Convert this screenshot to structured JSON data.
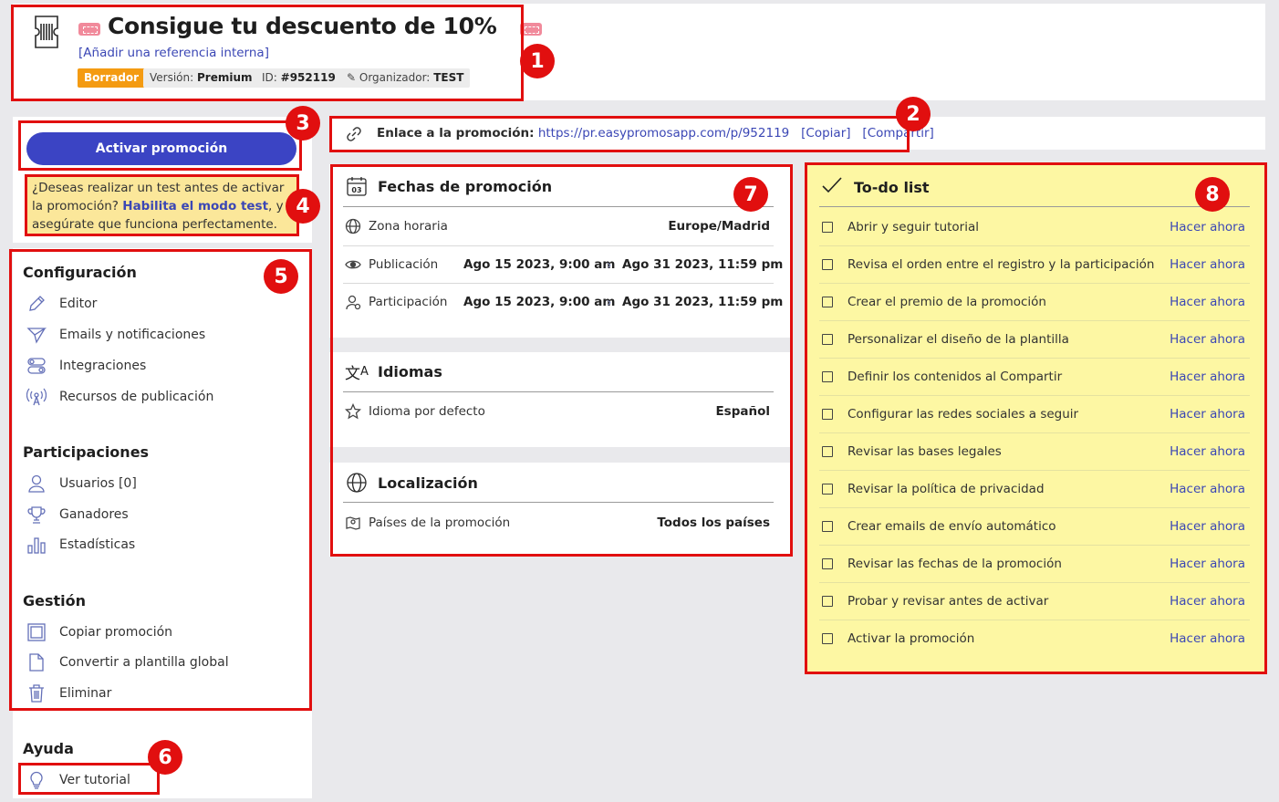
{
  "header": {
    "title": "Consigue tu descuento de 10%",
    "internal_ref": "Añadir una referencia interna",
    "status": "Borrador",
    "version_label": "Versión:",
    "version_value": "Premium",
    "id_label": "ID:",
    "id_value": "#952119",
    "organizer_label": "Organizador:",
    "organizer_value": "TEST"
  },
  "link_bar": {
    "label": "Enlace a la promoción:",
    "url": "https://pr.easypromosapp.com/p/952119",
    "copy": "Copiar",
    "share": "Compartir"
  },
  "activate": {
    "button": "Activar promoción",
    "test_text_1": "¿Deseas realizar un test antes de activar la promoción?",
    "test_link": "Habilita el modo test",
    "test_text_2": ", y asegúrate que funciona perfectamente."
  },
  "sidebar": {
    "config_title": "Configuración",
    "config_items": [
      "Editor",
      "Emails y notificaciones",
      "Integraciones",
      "Recursos de publicación"
    ],
    "part_title": "Participaciones",
    "part_items": [
      "Usuarios [0]",
      "Ganadores",
      "Estadísticas"
    ],
    "gest_title": "Gestión",
    "gest_items": [
      "Copiar promoción",
      "Convertir a plantilla global",
      "Eliminar"
    ],
    "help_title": "Ayuda",
    "help_item": "Ver tutorial"
  },
  "dates": {
    "title": "Fechas de promoción",
    "calendar_day": "03",
    "timezone_label": "Zona horaria",
    "timezone_value": "Europe/Madrid",
    "publication_label": "Publicación",
    "publication_start": "Ago 15 2023, 9:00 am",
    "publication_end": "Ago 31 2023, 11:59 pm",
    "participation_label": "Participación",
    "participation_start": "Ago 15 2023, 9:00 am",
    "participation_end": "Ago 31 2023, 11:59 pm"
  },
  "languages": {
    "title": "Idiomas",
    "default_label": "Idioma por defecto",
    "default_value": "Español"
  },
  "location": {
    "title": "Localización",
    "countries_label": "Países de la promoción",
    "countries_value": "Todos los países"
  },
  "todo": {
    "title": "To-do list",
    "action": "Hacer ahora",
    "items": [
      "Abrir y seguir tutorial",
      "Revisa el orden entre el registro y la participación",
      "Crear el premio de la promoción",
      "Personalizar el diseño de la plantilla",
      "Definir los contenidos al Compartir",
      "Configurar las redes sociales a seguir",
      "Revisar las bases legales",
      "Revisar la política de privacidad",
      "Crear emails de envío automático",
      "Revisar las fechas de la promoción",
      "Probar y revisar antes de activar",
      "Activar la promoción"
    ]
  },
  "annotations": [
    "1",
    "2",
    "3",
    "4",
    "5",
    "6",
    "7",
    "8"
  ],
  "colors": {
    "accent": "#3b47b5",
    "highlight_red": "#e10f0f",
    "draft_orange": "#f49b12",
    "todo_yellow": "#fdf7a3",
    "test_yellow": "#fbe79a"
  }
}
